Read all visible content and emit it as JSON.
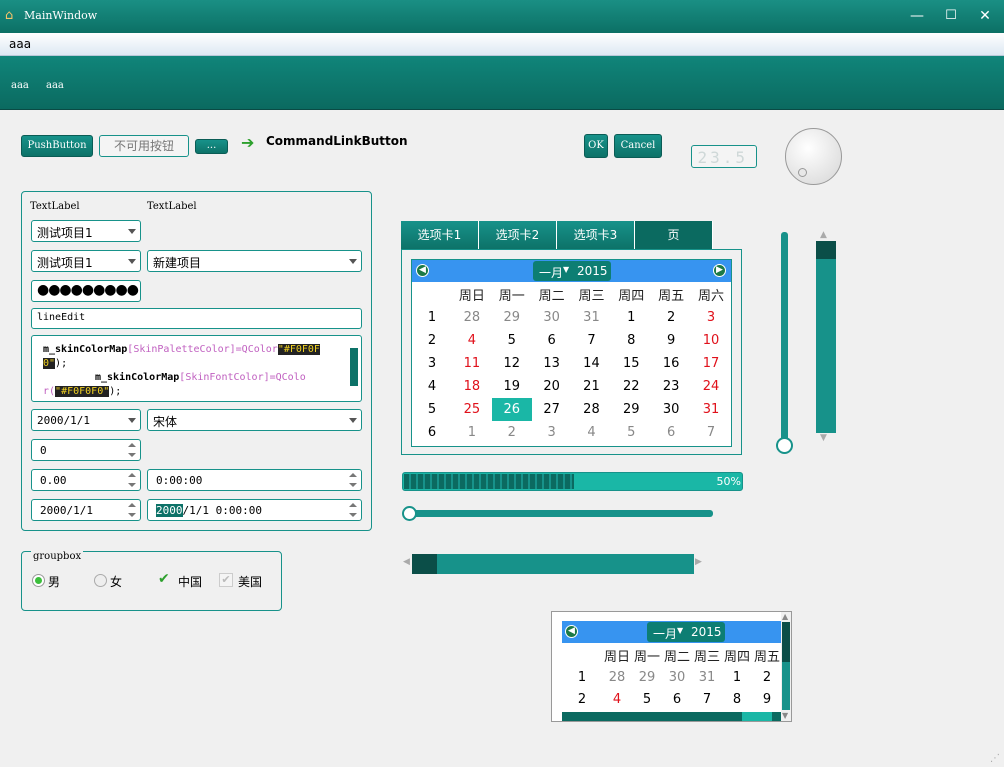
{
  "window": {
    "title": "MainWindow",
    "minimize": "—",
    "maximize": "☐",
    "close": "✕"
  },
  "menubar": {
    "item": "aaa"
  },
  "toolbar": {
    "items": [
      "aaa",
      "aaa"
    ]
  },
  "buttons": {
    "push": "PushButton",
    "disabled": "不可用按钮",
    "ellipsis": "...",
    "command_link": "CommandLinkButton",
    "ok": "OK",
    "cancel": "Cancel"
  },
  "lcd": {
    "value": "23.5"
  },
  "form": {
    "label1": "TextLabel",
    "label2": "TextLabel",
    "combo1": "测试项目1",
    "combo2": "测试项目1",
    "combo3": "新建项目",
    "password": "●●●●●●●●●",
    "line_edit": "lineEdit",
    "text_edit": {
      "line1_code": "m_skinColorMap",
      "line1_arg": "[SkinPaletteColor]=QColor",
      "line1_str": "\"#F0F0F",
      "line2_str": "0\"",
      "line2_tail": ");",
      "line3_code": "m_skinColorMap",
      "line3_arg": "[SkinFontColor]=QColo",
      "line4_arg": "r(",
      "line4_str": "\"#F0F0F0\"",
      "line4_tail": ");"
    },
    "date_combo": "2000/1/1",
    "font_combo": "宋体",
    "spin_int": "0",
    "spin_double": "0.00",
    "time_edit": "0:00:00",
    "date_edit": "2000/1/1",
    "datetime_selected": "2000",
    "datetime_rest": "/1/1 0:00:00"
  },
  "groupbox": {
    "title": "groupbox",
    "radio1": "男",
    "radio2": "女",
    "check1": "中国",
    "check2": "美国"
  },
  "tabs": [
    "选项卡1",
    "选项卡2",
    "选项卡3",
    "页"
  ],
  "calendar": {
    "month": "一月",
    "year": "2015",
    "weekdays": [
      "周日",
      "周一",
      "周二",
      "周三",
      "周四",
      "周五",
      "周六"
    ],
    "weeks": [
      {
        "wk": "1",
        "days": [
          "28",
          "29",
          "30",
          "31",
          "1",
          "2",
          "3"
        ]
      },
      {
        "wk": "2",
        "days": [
          "4",
          "5",
          "6",
          "7",
          "8",
          "9",
          "10"
        ]
      },
      {
        "wk": "3",
        "days": [
          "11",
          "12",
          "13",
          "14",
          "15",
          "16",
          "17"
        ]
      },
      {
        "wk": "4",
        "days": [
          "18",
          "19",
          "20",
          "21",
          "22",
          "23",
          "24"
        ]
      },
      {
        "wk": "5",
        "days": [
          "25",
          "26",
          "27",
          "28",
          "29",
          "30",
          "31"
        ]
      },
      {
        "wk": "6",
        "days": [
          "1",
          "2",
          "3",
          "4",
          "5",
          "6",
          "7"
        ]
      }
    ],
    "selected": "26"
  },
  "calendar_small": {
    "month": "一月",
    "year": "2015",
    "weekdays": [
      "周日",
      "周一",
      "周二",
      "周三",
      "周四",
      "周五"
    ],
    "weeks": [
      {
        "wk": "1",
        "days": [
          "28",
          "29",
          "30",
          "31",
          "1",
          "2"
        ]
      },
      {
        "wk": "2",
        "days": [
          "4",
          "5",
          "6",
          "7",
          "8",
          "9"
        ]
      }
    ]
  },
  "progress": {
    "value": 0.5,
    "label": "50%"
  },
  "colors": {
    "accent": "#17928a",
    "accent_dark": "#0b6a60",
    "weekend": "#e0101a",
    "selected": "#1ab7a6"
  }
}
